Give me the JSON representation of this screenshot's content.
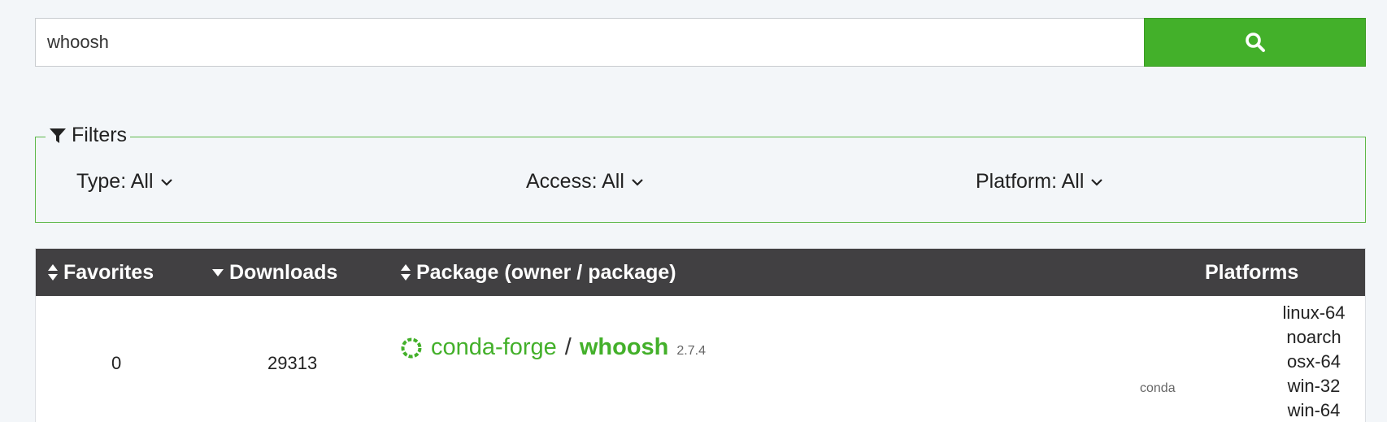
{
  "search": {
    "value": "whoosh",
    "placeholder": "",
    "button_icon": "search-icon"
  },
  "filters": {
    "legend": "Filters",
    "type_label": "Type: All",
    "access_label": "Access: All",
    "platform_label": "Platform: All"
  },
  "table": {
    "headers": {
      "favorites": "Favorites",
      "downloads": "Downloads",
      "package": "Package (owner / package)",
      "platforms": "Platforms"
    },
    "rows": [
      {
        "favorites": "0",
        "downloads": "29313",
        "owner": "conda-forge",
        "separator": "/",
        "package": "whoosh",
        "version": "2.7.4",
        "type": "conda",
        "platforms": [
          "linux-64",
          "noarch",
          "osx-64",
          "win-32",
          "win-64"
        ]
      }
    ]
  },
  "colors": {
    "accent": "#43b02a",
    "header_bg": "#414042",
    "page_bg": "#f3f6f9"
  }
}
